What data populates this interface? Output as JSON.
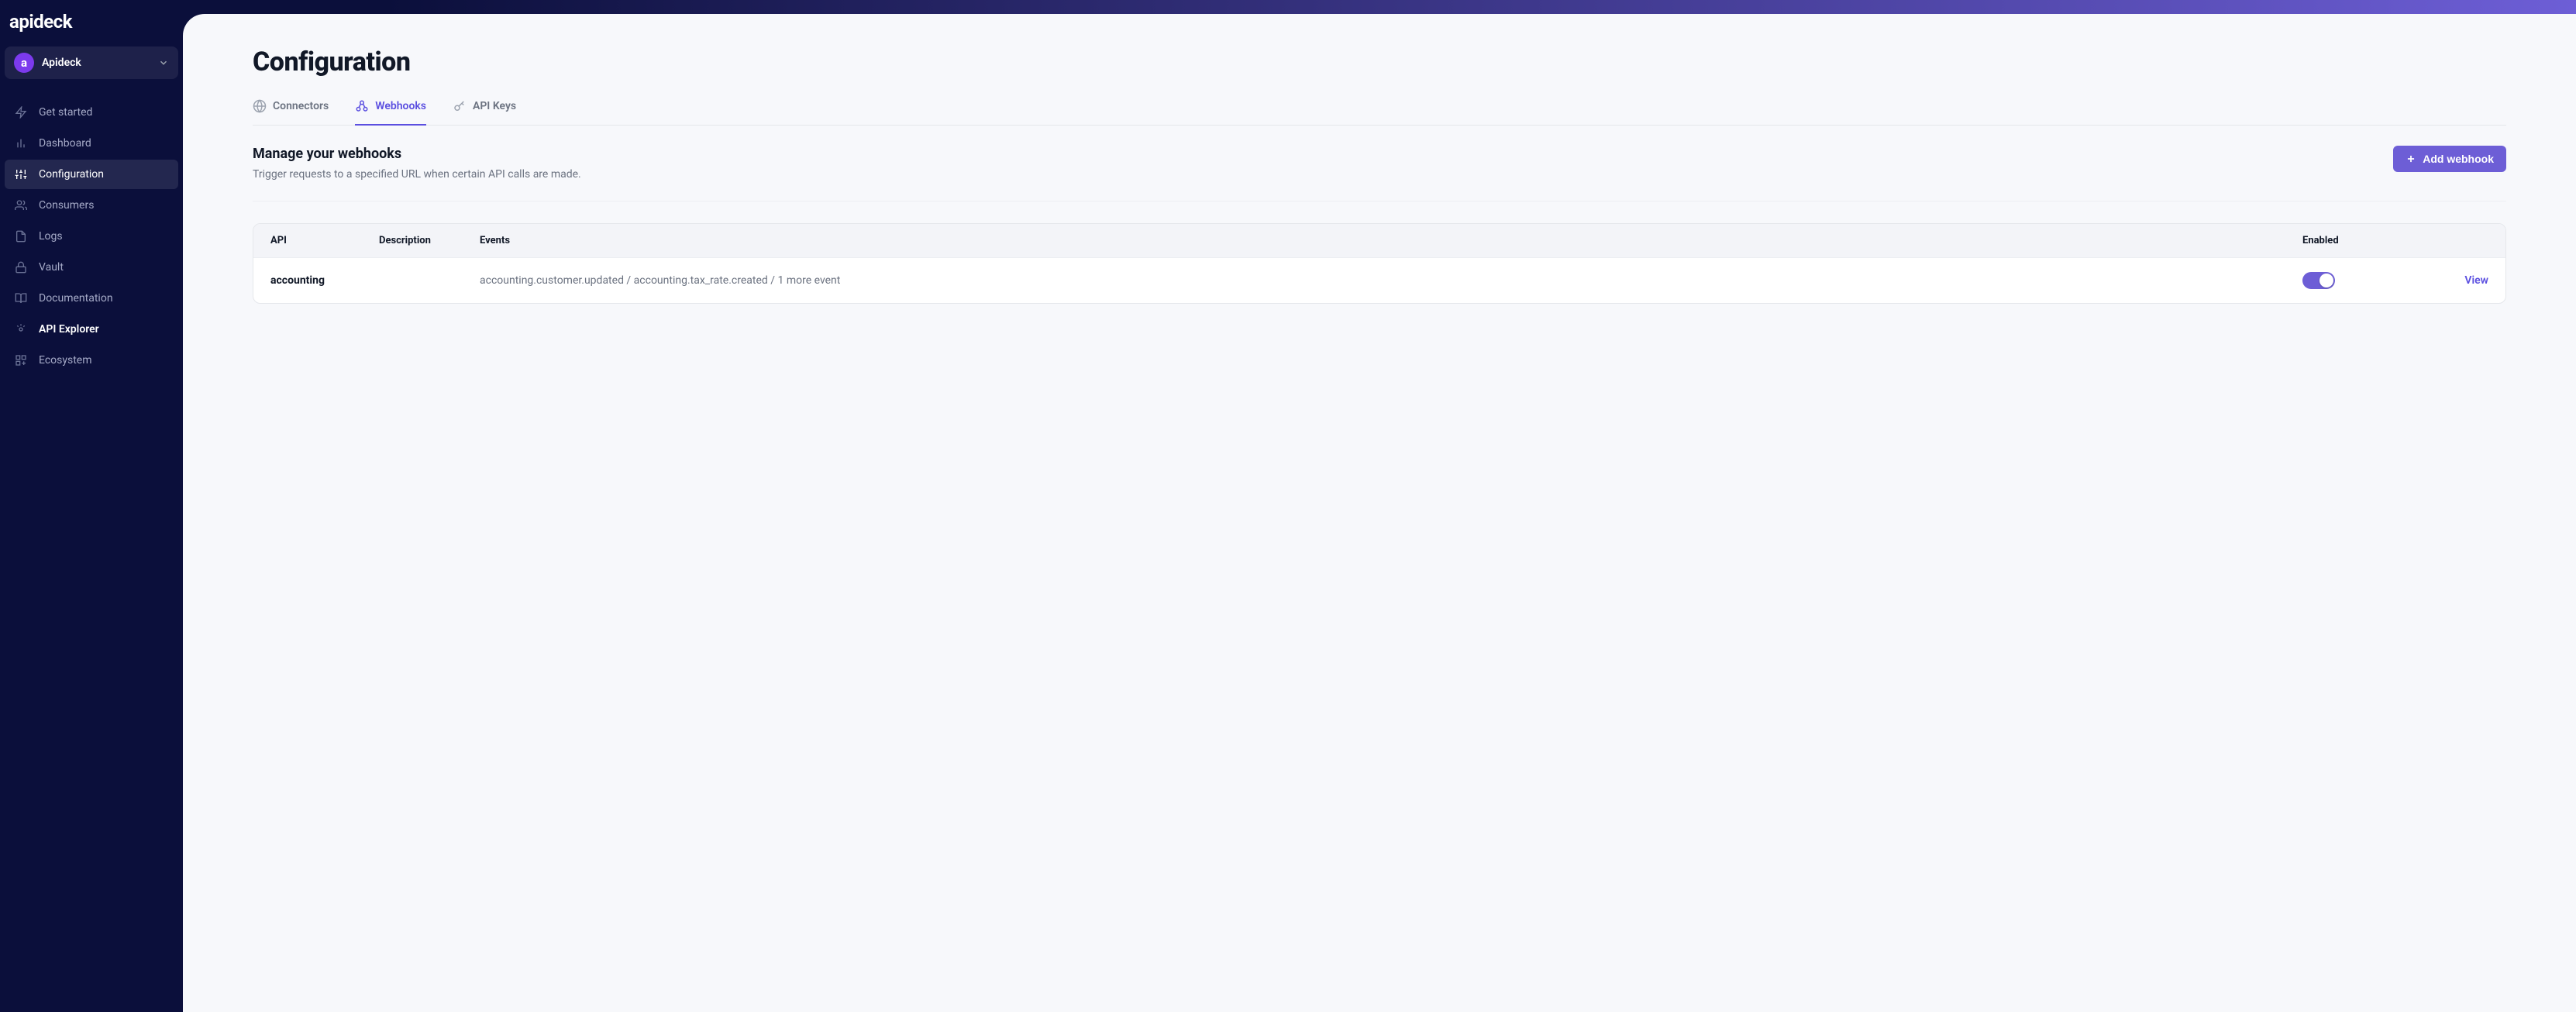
{
  "brand": "apideck",
  "workspace": {
    "avatar_letter": "a",
    "name": "Apideck"
  },
  "nav": {
    "items": [
      {
        "label": "Get started"
      },
      {
        "label": "Dashboard"
      },
      {
        "label": "Configuration"
      },
      {
        "label": "Consumers"
      },
      {
        "label": "Logs"
      },
      {
        "label": "Vault"
      },
      {
        "label": "Documentation"
      },
      {
        "label": "API Explorer"
      },
      {
        "label": "Ecosystem"
      }
    ]
  },
  "page": {
    "title": "Configuration"
  },
  "tabs": {
    "connectors": "Connectors",
    "webhooks": "Webhooks",
    "apikeys": "API Keys"
  },
  "section": {
    "title": "Manage your webhooks",
    "subtitle": "Trigger requests to a specified URL when certain API calls are made.",
    "add_button": "Add webhook"
  },
  "columns": {
    "api": "API",
    "description": "Description",
    "events": "Events",
    "enabled": "Enabled"
  },
  "rows": [
    {
      "api": "accounting",
      "description": "",
      "events": "accounting.customer.updated / accounting.tax_rate.created / 1 more event",
      "enabled": true,
      "view_label": "View"
    }
  ],
  "colors": {
    "accent": "#6d5ed6",
    "link": "#5b4fe0"
  }
}
